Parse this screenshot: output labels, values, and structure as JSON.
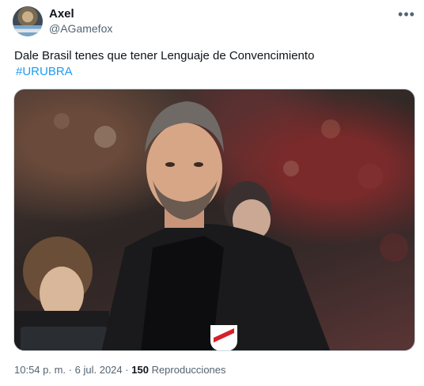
{
  "author": {
    "name": "Axel",
    "handle": "@AGamefox"
  },
  "tweet": {
    "text": "Dale Brasil tenes que tener Lenguaje de Convencimiento",
    "hashtag": "#URUBRA"
  },
  "media": {
    "subject": "man in black suit with crest badge at stadium at night"
  },
  "footer": {
    "time": "10:54 p. m.",
    "separator1": "·",
    "date": "6 jul. 2024",
    "separator2": "·",
    "views_count": "150",
    "views_label": "Reproducciones"
  },
  "colors": {
    "text": "#0f1419",
    "secondary": "#536471",
    "link": "#1d9bf0"
  },
  "icons": {
    "more": "more-options-icon"
  }
}
